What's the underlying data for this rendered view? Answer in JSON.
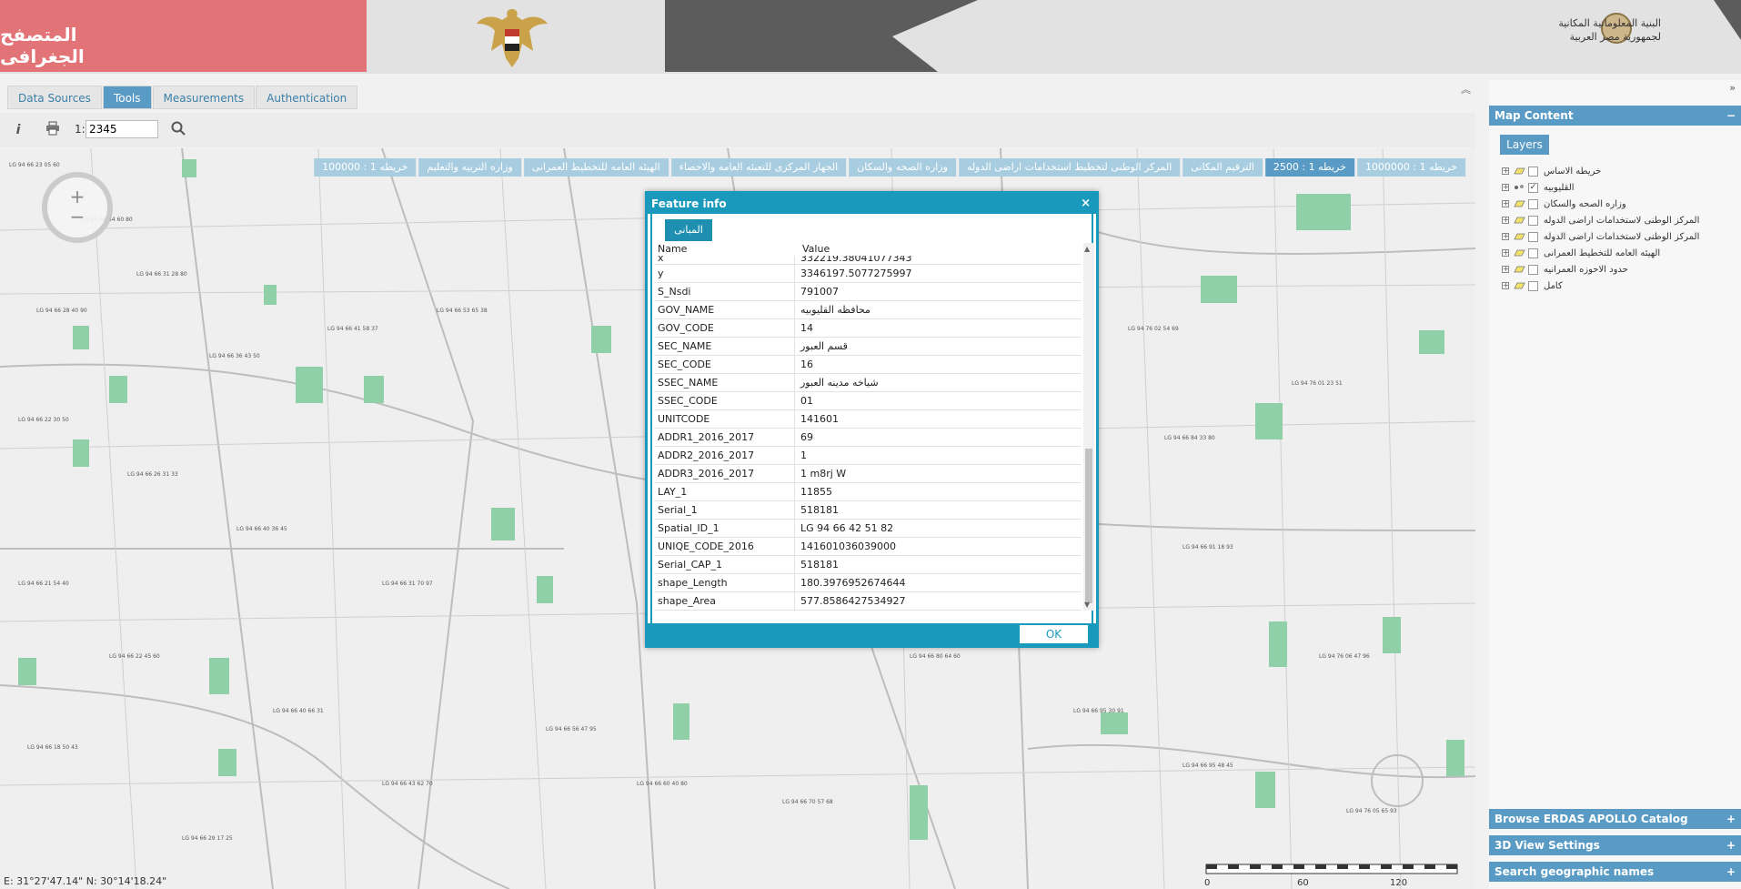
{
  "header": {
    "app_title": "المتصفح الجغرافى",
    "org_name_line1": "البنية المعلوماتية المكانية",
    "org_name_line2": "لجمهورية مصر العربية"
  },
  "tabs": [
    "Data Sources",
    "Tools",
    "Measurements",
    "Authentication"
  ],
  "toolbar": {
    "scale_prefix": "1:",
    "scale_value": "2345"
  },
  "base_layers": [
    "خريطه 1 : 1000000",
    "خريطه 1 : 2500",
    "الترقيم المكانى",
    "المركز الوطنى لتخطيط استخدامات اراضى الدوله",
    "وزاره الصحه والسكان",
    "الجهاز المركزى للتعبئه العامه والاحصاء",
    "الهيئه العامه للتخطيط العمرانى",
    "وزاره التربيه والتعليم",
    "خريطه 1 : 100000"
  ],
  "map": {
    "coords": "E: 31°27'47.14\"   N: 30°14'18.24\"",
    "scale_ticks": [
      "0",
      "60",
      "120"
    ]
  },
  "right_panel": {
    "map_content_title": "Map Content",
    "layers_button": "Layers",
    "layers": [
      {
        "label": "خريطه الاساس",
        "checked": false
      },
      {
        "label": "القليوبيه",
        "checked": true
      },
      {
        "label": "وزاره الصحه والسكان",
        "checked": false
      },
      {
        "label": "المركز الوطنى لاستخدامات اراضى الدوله",
        "checked": false
      },
      {
        "label": "المركز الوطنى لاستخدامات اراضى الدوله",
        "checked": false
      },
      {
        "label": "الهيئه العامه للتخطيط العمرانى",
        "checked": false
      },
      {
        "label": "حدود الاحوزه العمرانيه",
        "checked": false
      },
      {
        "label": "كامل",
        "checked": false
      }
    ],
    "browse_catalog": "Browse ERDAS APOLLO Catalog",
    "view_3d": "3D View Settings",
    "search_names": "Search geographic names"
  },
  "dialog": {
    "title": "Feature info",
    "close": "×",
    "tab": "المبانى",
    "col_name": "Name",
    "col_value": "Value",
    "cut_row": {
      "name": "x",
      "value": "332219.38041077343"
    },
    "rows": [
      {
        "name": "y",
        "value": "3346197.5077275997"
      },
      {
        "name": "S_Nsdi",
        "value": "791007"
      },
      {
        "name": "GOV_NAME",
        "value": "محافظه القليوبيه"
      },
      {
        "name": "GOV_CODE",
        "value": "14"
      },
      {
        "name": "SEC_NAME",
        "value": "قسم العبور"
      },
      {
        "name": "SEC_CODE",
        "value": "16"
      },
      {
        "name": "SSEC_NAME",
        "value": "شياخه مدينه العبور"
      },
      {
        "name": "SSEC_CODE",
        "value": "01"
      },
      {
        "name": "UNITCODE",
        "value": "141601"
      },
      {
        "name": "ADDR1_2016_2017",
        "value": "69"
      },
      {
        "name": "ADDR2_2016_2017",
        "value": "1"
      },
      {
        "name": "ADDR3_2016_2017",
        "value": "1 m8rj W"
      },
      {
        "name": "LAY_1",
        "value": "11855"
      },
      {
        "name": "Serial_1",
        "value": "518181"
      },
      {
        "name": "Spatial_ID_1",
        "value": "LG 94 66 42 51 82"
      },
      {
        "name": "UNIQE_CODE_2016",
        "value": "141601036039000"
      },
      {
        "name": "Serial_CAP_1",
        "value": "518181"
      },
      {
        "name": "shape_Length",
        "value": "180.3976952674644"
      },
      {
        "name": "shape_Area",
        "value": "577.8586427534927"
      }
    ],
    "ok_label": "OK"
  }
}
